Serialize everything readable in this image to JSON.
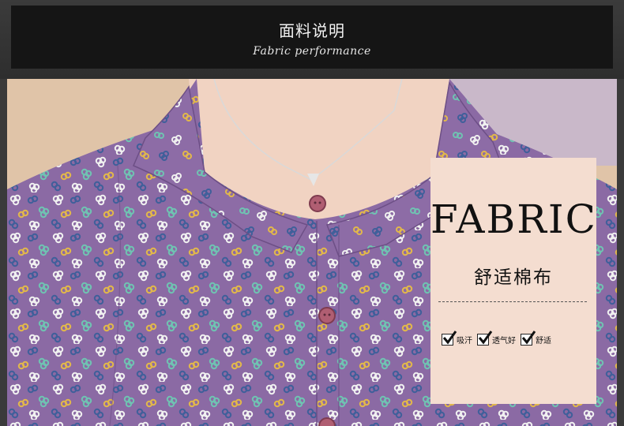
{
  "header": {
    "title_cn": "面料说明",
    "title_en": "Fabric performance"
  },
  "card": {
    "title": "FABRIC",
    "subtitle": "舒适棉布",
    "features": [
      {
        "label": "吸汗",
        "icon": "checkmark-icon"
      },
      {
        "label": "透气好",
        "icon": "checkmark-icon"
      },
      {
        "label": "舒适",
        "icon": "checkmark-icon"
      }
    ]
  },
  "colors": {
    "header_bg": "#151515",
    "fabric_purple": "#8a6aa3",
    "card_bg": "#f4ddd0",
    "button_color": "#a85b6e"
  }
}
